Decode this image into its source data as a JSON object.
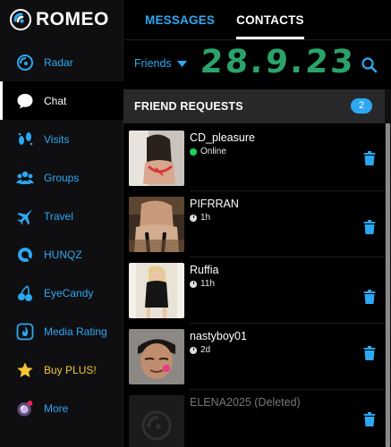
{
  "app": {
    "brand": "ROMEO"
  },
  "sidebar": {
    "items": [
      {
        "label": "Radar",
        "icon": "radar-icon",
        "active": false
      },
      {
        "label": "Chat",
        "icon": "chat-bubble-icon",
        "active": true
      },
      {
        "label": "Visits",
        "icon": "footprints-icon",
        "active": false
      },
      {
        "label": "Groups",
        "icon": "groups-icon",
        "active": false
      },
      {
        "label": "Travel",
        "icon": "plane-icon",
        "active": false
      },
      {
        "label": "HUNQZ",
        "icon": "hunqz-icon",
        "active": false
      },
      {
        "label": "EyeCandy",
        "icon": "cherries-icon",
        "active": false
      },
      {
        "label": "Media Rating",
        "icon": "flame-icon",
        "active": false
      },
      {
        "label": "Buy PLUS!",
        "icon": "star-icon",
        "active": false
      },
      {
        "label": "More",
        "icon": "avatar-icon",
        "active": false
      }
    ]
  },
  "tabs": {
    "messages": "MESSAGES",
    "contacts": "CONTACTS",
    "active": "contacts"
  },
  "filter": {
    "label": "Friends"
  },
  "handwritten_date": "28.9.23",
  "section": {
    "title": "FRIEND REQUESTS",
    "count": "2"
  },
  "requests": [
    {
      "name": "CD_pleasure",
      "status": "Online",
      "status_type": "online"
    },
    {
      "name": "PIFRRAN",
      "status": "1h",
      "status_type": "time"
    },
    {
      "name": "Ruffia",
      "status": "11h",
      "status_type": "time"
    },
    {
      "name": "nastyboy01",
      "status": "2d",
      "status_type": "time"
    },
    {
      "name": "ELENA2025 (Deleted)",
      "status": "",
      "status_type": "deleted"
    }
  ],
  "colors": {
    "accent": "#2ca8f2",
    "plus": "#f3c433",
    "online": "#1ed15f",
    "sidebar_bg": "#0f0f11",
    "section_bg": "#28282b"
  }
}
